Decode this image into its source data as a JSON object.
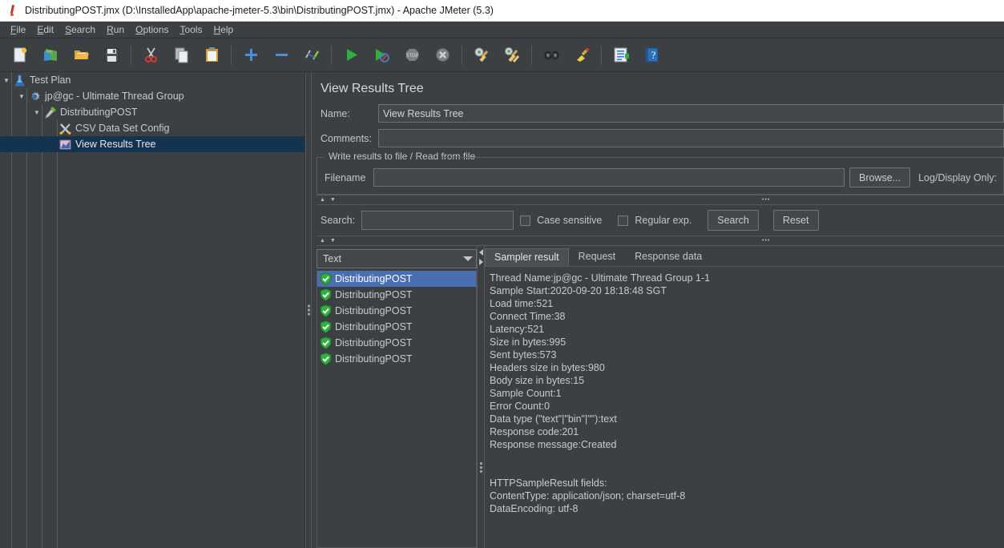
{
  "window": {
    "title": "DistributingPOST.jmx (D:\\InstalledApp\\apache-jmeter-5.3\\bin\\DistributingPOST.jmx) - Apache JMeter (5.3)",
    "app_icon": "jmeter-feather-icon"
  },
  "menubar": {
    "items": [
      {
        "mnemonic": "F",
        "rest": "ile"
      },
      {
        "mnemonic": "E",
        "rest": "dit"
      },
      {
        "mnemonic": "S",
        "rest": "earch"
      },
      {
        "mnemonic": "R",
        "rest": "un"
      },
      {
        "mnemonic": "O",
        "rest": "ptions"
      },
      {
        "mnemonic": "T",
        "rest": "ools"
      },
      {
        "mnemonic": "H",
        "rest": "elp"
      }
    ]
  },
  "toolbar": {
    "buttons": [
      {
        "name": "new-icon",
        "group": 1
      },
      {
        "name": "templates-icon",
        "group": 1
      },
      {
        "name": "open-icon",
        "group": 1
      },
      {
        "name": "save-icon",
        "group": 1
      },
      {
        "name": "cut-icon",
        "group": 2
      },
      {
        "name": "copy-icon",
        "group": 2
      },
      {
        "name": "paste-icon",
        "group": 2
      },
      {
        "name": "expand-all-icon",
        "group": 3
      },
      {
        "name": "collapse-all-icon",
        "group": 3
      },
      {
        "name": "toggle-icon",
        "group": 3
      },
      {
        "name": "start-icon",
        "group": 4
      },
      {
        "name": "start-no-timers-icon",
        "group": 4
      },
      {
        "name": "stop-icon",
        "group": 4
      },
      {
        "name": "shutdown-icon",
        "group": 4
      },
      {
        "name": "clear-icon",
        "group": 5
      },
      {
        "name": "clear-all-icon",
        "group": 5
      },
      {
        "name": "search-icon",
        "group": 6
      },
      {
        "name": "search-reset-icon",
        "group": 6
      },
      {
        "name": "function-helper-icon",
        "group": 7
      },
      {
        "name": "help-icon",
        "group": 7
      }
    ]
  },
  "tree": {
    "nodes": [
      {
        "label": "Test Plan",
        "icon": "test-plan-icon",
        "depth": 0,
        "twisty": "▼",
        "selected": false
      },
      {
        "label": "jp@gc - Ultimate Thread Group",
        "icon": "thread-group-icon",
        "depth": 1,
        "twisty": "▼",
        "selected": false
      },
      {
        "label": "DistributingPOST",
        "icon": "http-sampler-icon",
        "depth": 2,
        "twisty": "▼",
        "selected": false
      },
      {
        "label": "CSV Data Set Config",
        "icon": "csv-config-icon",
        "depth": 3,
        "twisty": "",
        "selected": false
      },
      {
        "label": "View Results Tree",
        "icon": "view-results-tree-icon",
        "depth": 3,
        "twisty": "",
        "selected": true
      }
    ]
  },
  "panel": {
    "title": "View Results Tree",
    "name_label": "Name:",
    "name_value": "View Results Tree",
    "comments_label": "Comments:",
    "comments_value": "",
    "file_group_title": "Write results to file / Read from file",
    "filename_label": "Filename",
    "filename_value": "",
    "browse_label": "Browse...",
    "log_display_only_label": "Log/Display Only:"
  },
  "search": {
    "label": "Search:",
    "value": "",
    "case_sensitive_label": "Case sensitive",
    "case_sensitive_checked": false,
    "regular_exp_label": "Regular exp.",
    "regular_exp_checked": false,
    "search_button": "Search",
    "reset_button": "Reset"
  },
  "collapse_bar": {
    "arrows": "▲ ▼",
    "dots": "•••"
  },
  "results": {
    "renderer_selected": "Text",
    "items": [
      {
        "label": "DistributingPOST",
        "status": "success-shield-icon",
        "selected": true
      },
      {
        "label": "DistributingPOST",
        "status": "success-shield-icon",
        "selected": false
      },
      {
        "label": "DistributingPOST",
        "status": "success-shield-icon",
        "selected": false
      },
      {
        "label": "DistributingPOST",
        "status": "success-shield-icon",
        "selected": false
      },
      {
        "label": "DistributingPOST",
        "status": "success-shield-icon",
        "selected": false
      },
      {
        "label": "DistributingPOST",
        "status": "success-shield-icon",
        "selected": false
      }
    ],
    "tabs": [
      {
        "label": "Sampler result",
        "active": true
      },
      {
        "label": "Request",
        "active": false
      },
      {
        "label": "Response data",
        "active": false
      }
    ],
    "sampler_result_text": "Thread Name:jp@gc - Ultimate Thread Group 1-1\nSample Start:2020-09-20 18:18:48 SGT\nLoad time:521\nConnect Time:38\nLatency:521\nSize in bytes:995\nSent bytes:573\nHeaders size in bytes:980\nBody size in bytes:15\nSample Count:1\nError Count:0\nData type (\"text\"|\"bin\"|\"\"):text\nResponse code:201\nResponse message:Created\n\n\nHTTPSampleResult fields:\nContentType: application/json; charset=utf-8\nDataEncoding: utf-8"
  },
  "colors": {
    "background": "#3c4043",
    "titlebar_bg": "#ffffff",
    "tree_selection": "#13334f",
    "list_selection": "#4a6fb0",
    "text": "#c8cacc",
    "success_green": "#2faf3e"
  }
}
